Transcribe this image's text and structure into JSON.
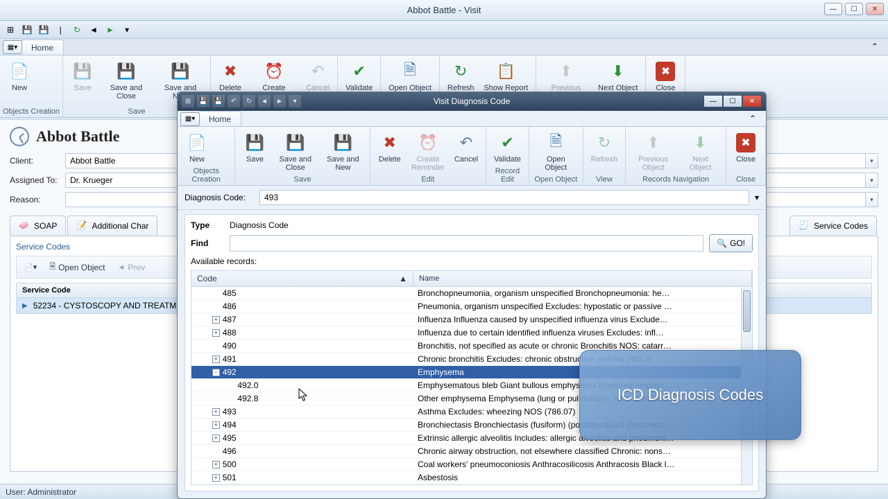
{
  "mainWindow": {
    "title": "Abbot Battle - Visit",
    "tabs": {
      "home": "Home"
    },
    "ribbon": {
      "buttons": {
        "new": "New",
        "save": "Save",
        "saveClose": "Save and Close",
        "saveNew": "Save and New",
        "delete": "Delete",
        "createReminder": "Create Reminder",
        "cancel": "Cancel",
        "validate": "Validate",
        "openObject": "Open Object",
        "refresh": "Refresh",
        "showReport": "Show Report",
        "prevObject": "Previous Object",
        "nextObject": "Next Object",
        "close": "Close"
      },
      "groups": {
        "objectsCreation": "Objects Creation",
        "save": "Save"
      }
    },
    "patientHeader": "Abbot Battle",
    "form": {
      "clientLabel": "Client:",
      "clientValue": "Abbot Battle",
      "assignedLabel": "Assigned To:",
      "assignedValue": "Dr. Krueger",
      "reasonLabel": "Reason:",
      "reasonValue": ""
    },
    "subtabs": {
      "soap": "SOAP",
      "additional": "Additional Char",
      "serviceCodes": "Service Codes"
    },
    "panel": {
      "title": "Service Codes",
      "toolbar": {
        "openObject": "Open Object",
        "prev": "Prev"
      },
      "gridHeader": "Service Code",
      "gridRow": "52234 - CYSTOSCOPY AND TREATMEN"
    },
    "status": "User: Administrator"
  },
  "dialog": {
    "title": "Visit Diagnosis Code",
    "tabs": {
      "home": "Home"
    },
    "ribbon": {
      "buttons": {
        "new": "New",
        "save": "Save",
        "saveClose": "Save and Close",
        "saveNew": "Save and New",
        "delete": "Delete",
        "createReminder": "Create Reminder",
        "cancel": "Cancel",
        "validate": "Validate",
        "openObject": "Open Object",
        "refresh": "Refresh",
        "prevObject": "Previous Object",
        "nextObject": "Next Object",
        "close": "Close"
      },
      "groups": {
        "objectsCreation": "Objects Creation",
        "save": "Save",
        "edit": "Edit",
        "recordEdit": "Record Edit",
        "openObject": "Open Object",
        "view": "View",
        "recordsNav": "Records Navigation",
        "close": "Close"
      }
    },
    "dcLabel": "Diagnosis Code:",
    "dcValue": "493",
    "typeLabel": "Type",
    "typeValue": "Diagnosis Code",
    "findLabel": "Find",
    "findValue": "",
    "goLabel": "GO!",
    "availableLabel": "Available records:",
    "columns": {
      "code": "Code",
      "name": "Name"
    },
    "rows": [
      {
        "indent": 1,
        "exp": "",
        "code": "485",
        "name": "Bronchopneumonia, organism unspecified Bronchopneumonia: he…"
      },
      {
        "indent": 1,
        "exp": "",
        "code": "486",
        "name": "Pneumonia, organism unspecified Excludes: hypostatic or passive …"
      },
      {
        "indent": 1,
        "exp": "+",
        "code": "487",
        "name": "Influenza Influenza caused by unspecified influenza virus Exclude…"
      },
      {
        "indent": 1,
        "exp": "+",
        "code": "488",
        "name": "Influenza due to certain identified influenza viruses Excludes: infl…"
      },
      {
        "indent": 1,
        "exp": "",
        "code": "490",
        "name": "Bronchitis, not specified as acute or chronic Bronchitis NOS: catarr…"
      },
      {
        "indent": 1,
        "exp": "+",
        "code": "491",
        "name": "Chronic bronchitis Excludes: chronic obstructive asthma (493.2)"
      },
      {
        "indent": 1,
        "exp": "-",
        "code": "492",
        "name": "Emphysema",
        "selected": true
      },
      {
        "indent": 2,
        "exp": "",
        "code": "492.0",
        "name": "Emphysematous bleb Giant bullous emphysema Ruptured emphys…"
      },
      {
        "indent": 2,
        "exp": "",
        "code": "492.8",
        "name": "Other emphysema Emphysema (lung or pulmonary): NOS centriaci…"
      },
      {
        "indent": 1,
        "exp": "+",
        "code": "493",
        "name": "Asthma Excludes: wheezing NOS (786.07)"
      },
      {
        "indent": 1,
        "exp": "+",
        "code": "494",
        "name": "Bronchiectasis Bronchiectasis (fusiform) (postinfectious) (recurrent…"
      },
      {
        "indent": 1,
        "exp": "+",
        "code": "495",
        "name": "Extrinsic allergic alveolitis Includes: allergic alveolitis and pneumoni…"
      },
      {
        "indent": 1,
        "exp": "",
        "code": "496",
        "name": "Chronic airway obstruction, not elsewhere classified Chronic: nons…"
      },
      {
        "indent": 1,
        "exp": "+",
        "code": "500",
        "name": "Coal workers' pneumoconiosis Anthracosilicosis Anthracosis Black l…"
      },
      {
        "indent": 1,
        "exp": "+",
        "code": "501",
        "name": "Asbestosis"
      }
    ]
  },
  "callout": "ICD Diagnosis Codes"
}
